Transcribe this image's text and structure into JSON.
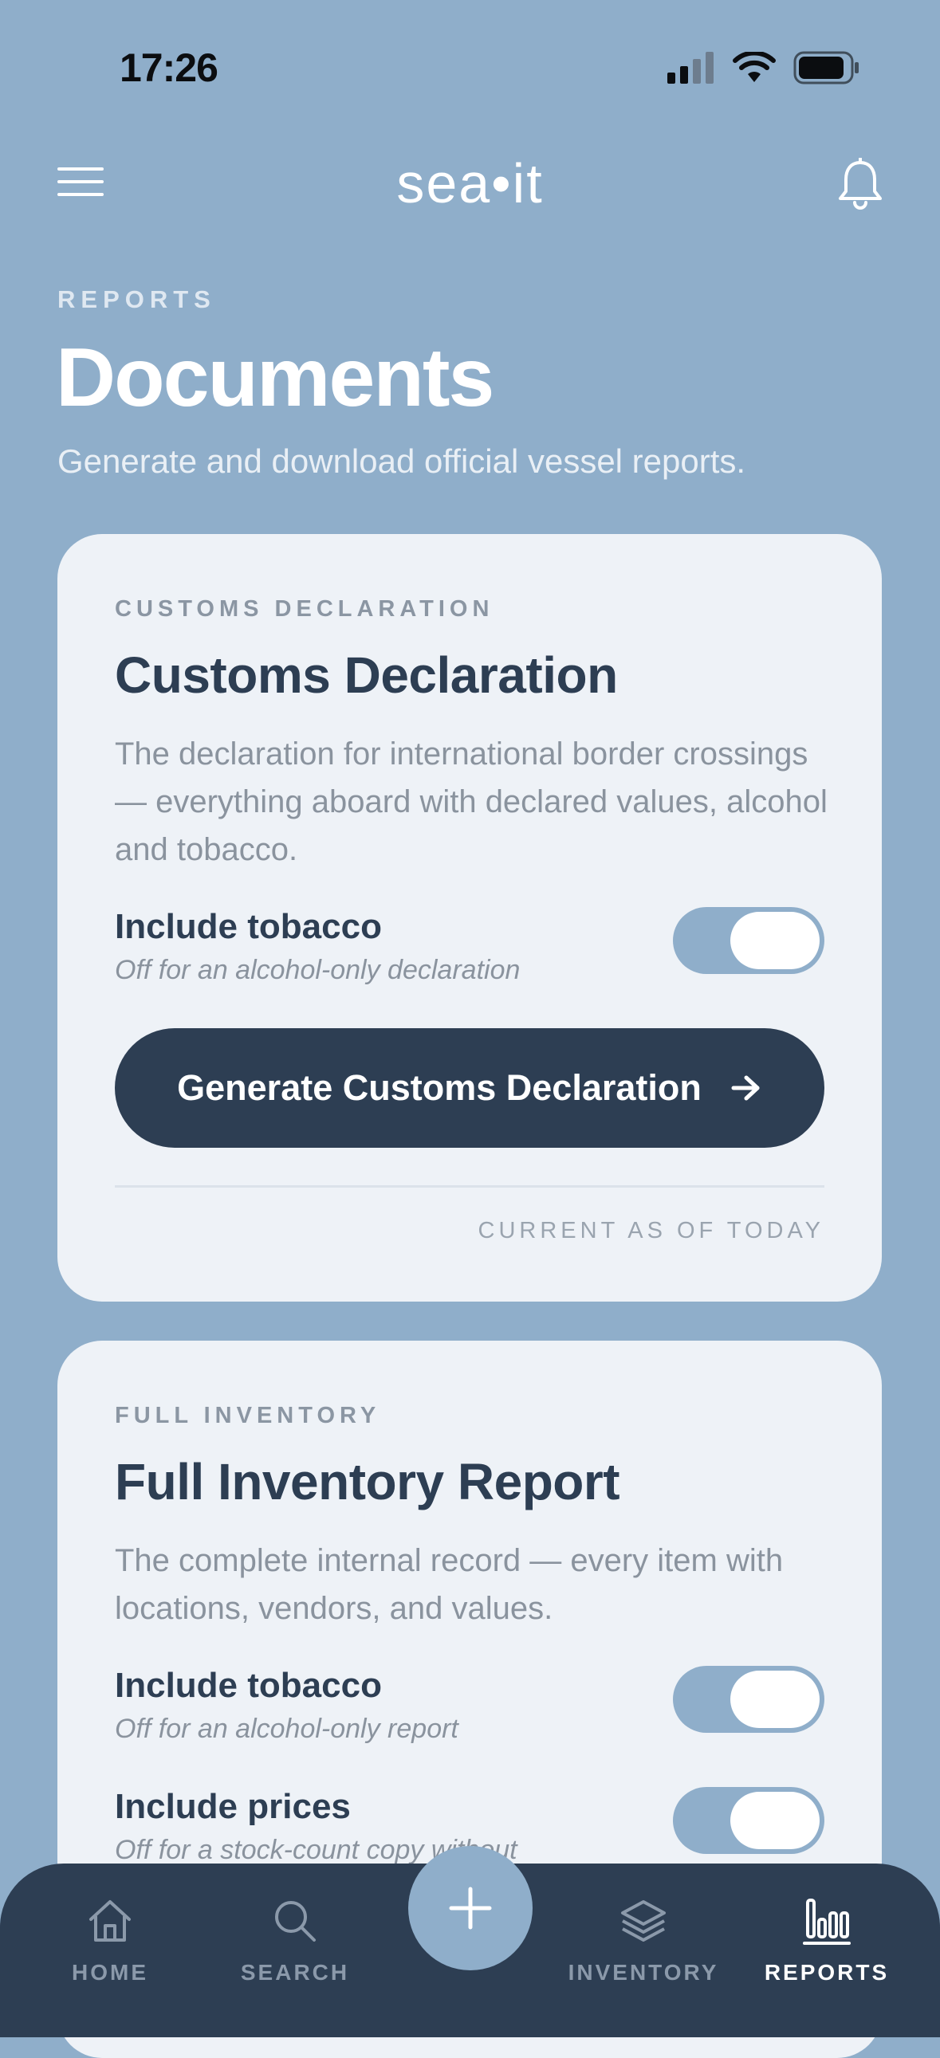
{
  "status_bar": {
    "time": "17:26"
  },
  "header": {
    "logo": "sea•it"
  },
  "page": {
    "eyebrow": "REPORTS",
    "title": "Documents",
    "subtitle": "Generate and download official vessel reports."
  },
  "cards": [
    {
      "eyebrow": "CUSTOMS DECLARATION",
      "title": "Customs Declaration",
      "description": "The declaration for international border crossings — everything aboard with declared values, alcohol and tobacco.",
      "toggles": [
        {
          "label": "Include tobacco",
          "hint": "Off for an alcohol-only declaration",
          "on": true
        }
      ],
      "button_label": "Generate Customs Declaration",
      "footer": "CURRENT AS OF TODAY"
    },
    {
      "eyebrow": "FULL INVENTORY",
      "title": "Full Inventory Report",
      "description": "The complete internal record — every item with locations, vendors, and values.",
      "toggles": [
        {
          "label": "Include tobacco",
          "hint": "Off for an alcohol-only report",
          "on": true
        },
        {
          "label": "Include prices",
          "hint": "Off for a stock-count copy without",
          "on": true
        }
      ]
    }
  ],
  "tabs": [
    {
      "label": "HOME",
      "icon": "home-icon"
    },
    {
      "label": "SEARCH",
      "icon": "search-icon"
    },
    {
      "label": "INVENTORY",
      "icon": "layers-icon"
    },
    {
      "label": "REPORTS",
      "icon": "bar-chart-icon",
      "active": true
    }
  ],
  "fab": {
    "icon": "plus-icon"
  },
  "colors": {
    "background": "#8faeca",
    "card": "#eef2f7",
    "primary": "#2d3e53",
    "muted": "#8a939e",
    "toggle_track": "#8faeca"
  }
}
